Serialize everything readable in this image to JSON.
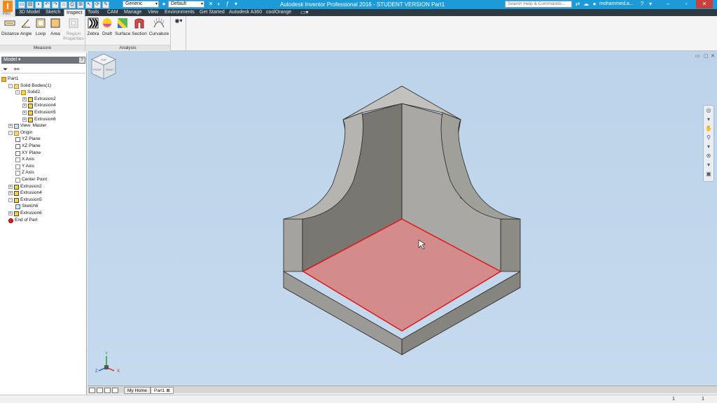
{
  "app": {
    "logo_letter": "I",
    "logo_badge": "PRO",
    "window_title": "Autodesk Inventor Professional 2016 - STUDENT VERSION    Part1",
    "search_placeholder": "Search Help & Commands...",
    "user_name": "mohammed.a...",
    "material_combo": "Generic",
    "appearance_combo": "Default"
  },
  "ribbon_tabs": [
    {
      "label": "3D Model"
    },
    {
      "label": "Sketch"
    },
    {
      "label": "Inspect",
      "active": true
    },
    {
      "label": "Tools"
    },
    {
      "label": "CAM"
    },
    {
      "label": "Manage"
    },
    {
      "label": "View"
    },
    {
      "label": "Environments"
    },
    {
      "label": "Get Started"
    },
    {
      "label": "Autodesk A360"
    },
    {
      "label": "coolOrange"
    }
  ],
  "ribbon": {
    "measure": {
      "title": "Measure",
      "buttons": [
        {
          "label": "Distance"
        },
        {
          "label": "Angle"
        },
        {
          "label": "Loop"
        },
        {
          "label": "Area"
        },
        {
          "label": "Region Properties",
          "label1": "Region",
          "label2": "Properties",
          "enabled": false
        }
      ]
    },
    "analysis": {
      "title": "Analysis",
      "buttons": [
        {
          "label": "Zebra"
        },
        {
          "label": "Draft"
        },
        {
          "label": "Surface"
        },
        {
          "label": "Section"
        },
        {
          "label": "Curvature"
        }
      ]
    }
  },
  "browser": {
    "title": "Model",
    "help_glyph": "?",
    "tree": [
      {
        "label": "Part1",
        "depth": 0,
        "icon": "part-icon",
        "expander": ""
      },
      {
        "label": "Solid Bodies(1)",
        "depth": 1,
        "icon": "folder-icon",
        "expander": "-"
      },
      {
        "label": "Solid2",
        "depth": 2,
        "icon": "solid-body-icon",
        "expander": "-"
      },
      {
        "label": "Extrusion2",
        "depth": 3,
        "icon": "extrusion-icon",
        "expander": "+"
      },
      {
        "label": "Extrusion4",
        "depth": 3,
        "icon": "extrusion-icon",
        "expander": "+"
      },
      {
        "label": "Extrusion5",
        "depth": 3,
        "icon": "extrusion-icon",
        "expander": "+"
      },
      {
        "label": "Extrusion6",
        "depth": 3,
        "icon": "extrusion-icon",
        "expander": "+"
      },
      {
        "label": "View: Master",
        "depth": 1,
        "icon": "view-icon",
        "expander": "+"
      },
      {
        "label": "Origin",
        "depth": 1,
        "icon": "folder-icon",
        "expander": "-"
      },
      {
        "label": "YZ Plane",
        "depth": 2,
        "icon": "plane-icon",
        "expander": ""
      },
      {
        "label": "XZ Plane",
        "depth": 2,
        "icon": "plane-icon",
        "expander": ""
      },
      {
        "label": "XY Plane",
        "depth": 2,
        "icon": "plane-icon",
        "expander": ""
      },
      {
        "label": "X Axis",
        "depth": 2,
        "icon": "axis-icon",
        "expander": ""
      },
      {
        "label": "Y Axis",
        "depth": 2,
        "icon": "axis-icon",
        "expander": ""
      },
      {
        "label": "Z Axis",
        "depth": 2,
        "icon": "axis-icon",
        "expander": ""
      },
      {
        "label": "Center Point",
        "depth": 2,
        "icon": "point-icon",
        "expander": ""
      },
      {
        "label": "Extrusion2",
        "depth": 1,
        "icon": "extrusion-icon",
        "expander": "+"
      },
      {
        "label": "Extrusion4",
        "depth": 1,
        "icon": "extrusion-icon",
        "expander": "+"
      },
      {
        "label": "Extrusion5",
        "depth": 1,
        "icon": "extrusion-icon",
        "expander": "-"
      },
      {
        "label": "Sketch6",
        "depth": 2,
        "icon": "sketch-icon",
        "expander": ""
      },
      {
        "label": "Extrusion6",
        "depth": 1,
        "icon": "extrusion-icon",
        "expander": "+"
      },
      {
        "label": "End of Part",
        "depth": 1,
        "icon": "end-of-part-icon",
        "expander": ""
      }
    ]
  },
  "viewcube": {
    "face_top": "TOP",
    "face_front": "FRONT",
    "face_right": "RIGHT"
  },
  "triad": {
    "x": "X",
    "y": "Y",
    "z": "Z"
  },
  "doc_tabs": [
    {
      "label": "My Home"
    },
    {
      "label": "Part1",
      "active": true
    }
  ],
  "status": {
    "left_count": "1",
    "right_count": "1"
  },
  "colors": {
    "title_bar": "#1d9bd9",
    "ribbon_tab_bar": "#2d3a44",
    "viewport_bg": "#c0d6eb",
    "face_highlight": "#d38b8b",
    "highlight_edge": "#e01818"
  }
}
